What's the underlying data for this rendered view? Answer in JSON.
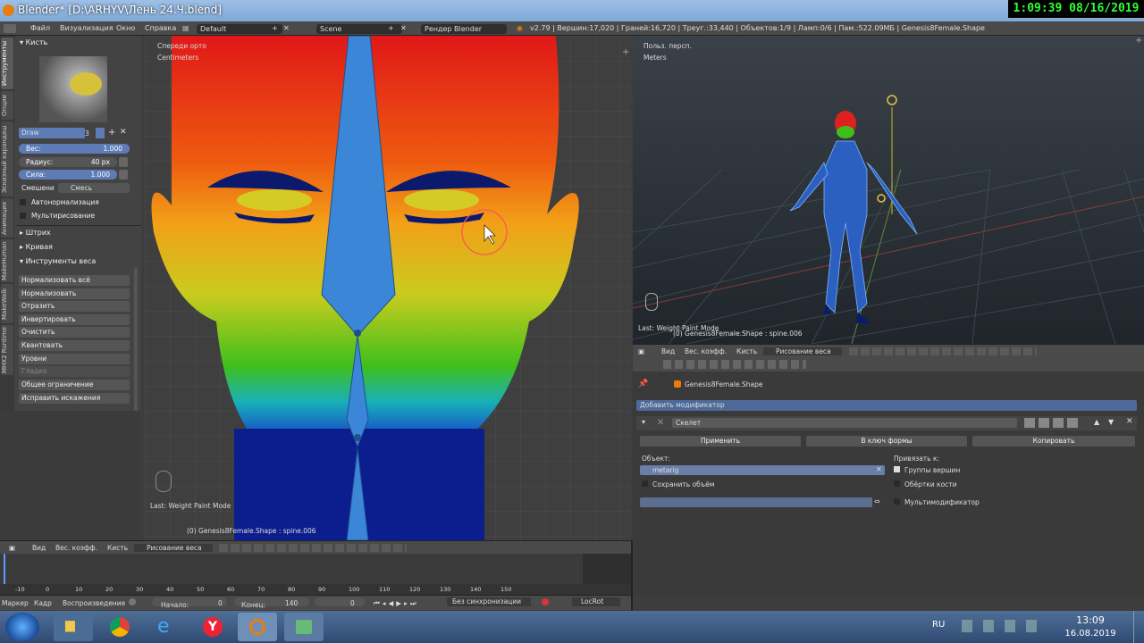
{
  "window": {
    "title": "Blender* [D:\\ARHYV\\Лень 24.Ч.blend]"
  },
  "clock_overlay": "1:09:39  08/16/2019",
  "menu": [
    "Файл",
    "Визуализация",
    "Окно",
    "Справка"
  ],
  "infobar": {
    "layout": "Default",
    "scene": "Scene",
    "engine": "Рендер Blender",
    "stats": "v2.79 | Вершин:17,020 | Граней:16,720 | Треуг.:33,440 | Объектов:1/9 | Ламп:0/6 | Пам.:522.09МБ | Genesis8Female.Shape"
  },
  "left_panel": {
    "vtabs": [
      "Инструменты",
      "Опции",
      "Эскизный карандаш",
      "Анимация",
      "MakeHuman",
      "MakeWalk",
      "MHX2 Runtime"
    ],
    "brush_header": "Кисть",
    "brush_name": "Draw",
    "brush_users": "3",
    "weight_label": "Вес:",
    "weight_value": "1.000",
    "radius_label": "Радиус:",
    "radius_value": "40 px",
    "strength_label": "Сила:",
    "strength_value": "1.000",
    "blend_label": "Смешени",
    "blend_value": "Смесь",
    "autonormalize": "Автонормализация",
    "multipaint": "Мультирисование",
    "stroke": "Штрих",
    "curve": "Кривая",
    "weight_tools": "Инструменты веса",
    "tools": [
      "Нормализовать всё",
      "Нормализовать",
      "Отразить",
      "Инвертировать",
      "Очистить",
      "Квантовать",
      "Уровни",
      "Гладко",
      "Общее ограничение",
      "Исправить искажения"
    ]
  },
  "viewport_left": {
    "view_label": "Спереди орто",
    "units": "Centimeters",
    "last_op": "Last: Weight Paint Mode",
    "object_info": "(0) Genesis8Female.Shape : spine.006",
    "header": {
      "view": "Вид",
      "weights": "Вес. коэфф.",
      "brush": "Кисть",
      "mode": "Рисование веса"
    }
  },
  "viewport_right": {
    "view_label": "Польз. персп.",
    "units": "Meters",
    "last_op": "Last: Weight Paint Mode",
    "object_info": "(0) Genesis8Female.Shape : spine.006",
    "header": {
      "view": "Вид",
      "weights": "Вес. коэфф.",
      "brush": "Кисть",
      "mode": "Рисование веса"
    }
  },
  "properties": {
    "object_name": "Genesis8Female.Shape",
    "add_modifier": "Добавить модификатор",
    "modifier_name": "Скелет",
    "apply": "Применить",
    "to_shape": "В ключ формы",
    "copy": "Копировать",
    "object_label": "Объект:",
    "object_value": "metarig",
    "preserve_volume": "Сохранить объём",
    "bind_to": "Привязать к:",
    "vertex_groups": "Группы вершин",
    "bone_envelopes": "Обёртки кости",
    "multi_modifier": "Мультимодификатор"
  },
  "timeline": {
    "ticks": [
      "-10",
      "0",
      "10",
      "20",
      "30",
      "40",
      "50",
      "60",
      "70",
      "80",
      "90",
      "100",
      "110",
      "120",
      "130",
      "140",
      "150"
    ],
    "marker": "Маркер",
    "frame": "Кадр",
    "playback": "Воспроизведение",
    "start_label": "Начало:",
    "start_value": "0",
    "end_label": "Конец:",
    "end_value": "140",
    "current": "0",
    "sync": "Без синхронизации",
    "keying": "LocRot"
  },
  "taskbar": {
    "lang": "RU",
    "time": "13:09",
    "date": "16.08.2019"
  },
  "colors": {
    "accent_blue": "#5d7cb5",
    "blender_orange": "#e87d0d"
  }
}
